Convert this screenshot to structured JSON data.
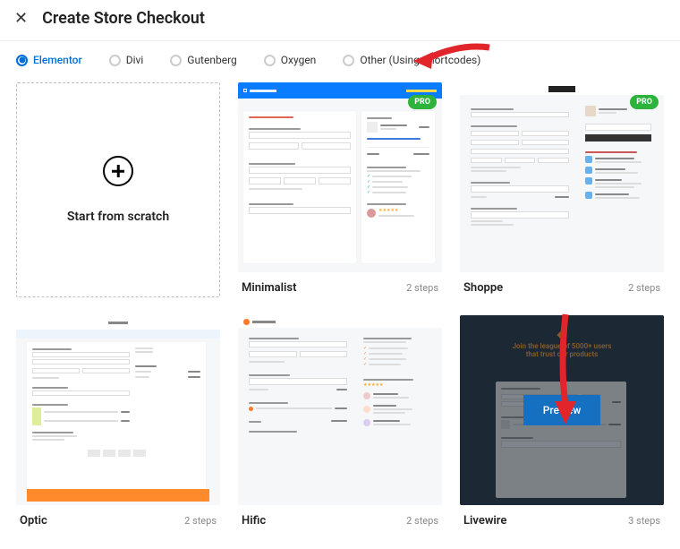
{
  "header": {
    "title": "Create Store Checkout"
  },
  "builders": [
    {
      "label": "Elementor",
      "selected": true
    },
    {
      "label": "Divi",
      "selected": false
    },
    {
      "label": "Gutenberg",
      "selected": false
    },
    {
      "label": "Oxygen",
      "selected": false
    },
    {
      "label": "Other (Using Shortcodes)",
      "selected": false
    }
  ],
  "scratch": {
    "label": "Start from scratch"
  },
  "templates": [
    {
      "title": "Minimalist",
      "steps": "2 steps",
      "pro": true
    },
    {
      "title": "Shoppe",
      "steps": "2 steps",
      "pro": true
    },
    {
      "title": "Optic",
      "steps": "2 steps",
      "pro": false
    },
    {
      "title": "Hific",
      "steps": "2 steps",
      "pro": false
    },
    {
      "title": "Livewire",
      "steps": "3 steps",
      "pro": false
    }
  ],
  "preview": {
    "button": "Preview",
    "tagline1": "Join the league of 5000+ users",
    "tagline2": "that trust our products"
  },
  "badges": {
    "pro": "PRO"
  }
}
